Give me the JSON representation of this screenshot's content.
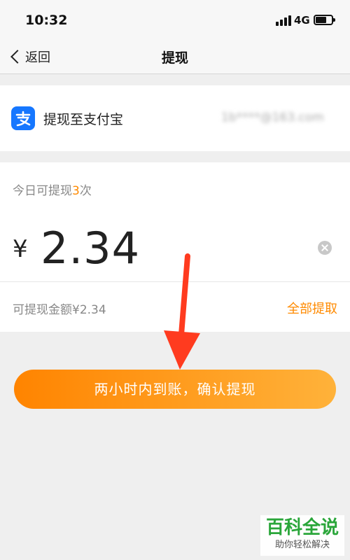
{
  "status_bar": {
    "time": "10:32",
    "network": "4G"
  },
  "nav": {
    "back_label": "返回",
    "title": "提现"
  },
  "account": {
    "label": "提现至支付宝",
    "masked_account": "1b****@163.com"
  },
  "withdraw": {
    "today_prefix": "今日可提现",
    "today_count": "3",
    "today_suffix": "次",
    "currency": "¥",
    "amount": "2.34",
    "available_text": "可提现金额¥2.34",
    "withdraw_all": "全部提取"
  },
  "confirm_button": "两小时内到账，确认提现",
  "watermark": {
    "title": "百科全说",
    "subtitle": "助你轻松解决"
  },
  "colors": {
    "accent": "#ff8a00",
    "alipay_blue": "#1677ff",
    "annotation_arrow": "#ff3b1f"
  }
}
